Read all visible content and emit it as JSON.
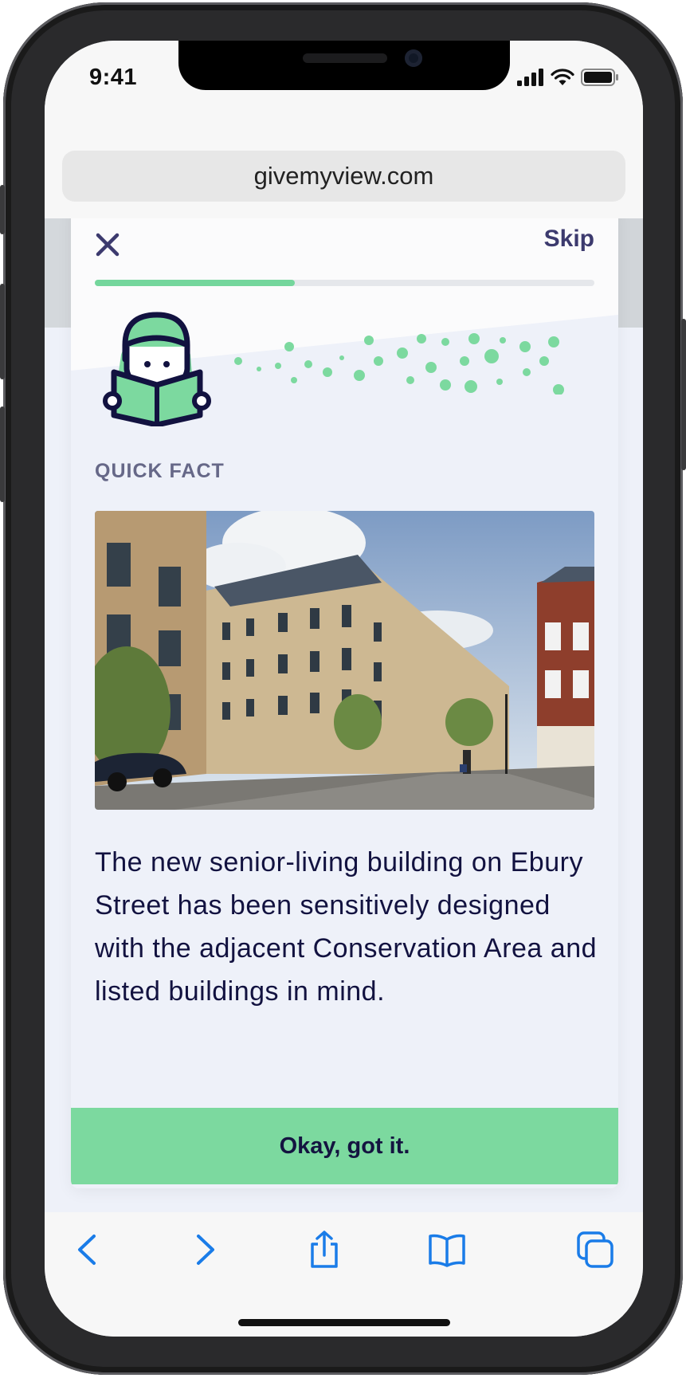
{
  "status_bar": {
    "time": "9:41"
  },
  "browser": {
    "url": "givemyview.com"
  },
  "modal": {
    "skip_label": "Skip",
    "progress": 0.4,
    "section_label": "QUICK FACT",
    "description": "The new senior-living building on Ebury Street has been sensitively designed with the adjacent Conservation Area and listed buildings in mind.",
    "ok_label": "Okay, got it."
  },
  "toolbar": {
    "icons": [
      "back-icon",
      "forward-icon",
      "share-icon",
      "bookmarks-icon",
      "tabs-icon"
    ]
  },
  "colors": {
    "accent_green": "#7cd99f",
    "navy": "#121240",
    "progress_track": "#e5e7eb",
    "ios_blue": "#1a7ce8"
  }
}
